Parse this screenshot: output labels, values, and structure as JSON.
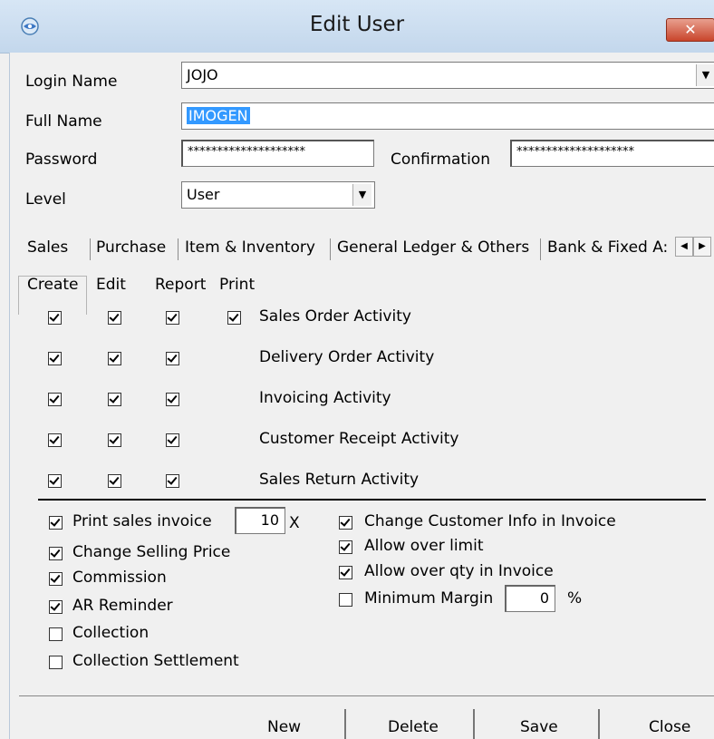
{
  "window": {
    "title": "Edit User",
    "close_label": "✕"
  },
  "form": {
    "login_name_label": "Login Name",
    "login_name_value": "JOJO",
    "full_name_label": "Full Name",
    "full_name_value": "IMOGEN",
    "password_label": "Password",
    "password_value": "********************",
    "confirmation_label": "Confirmation",
    "confirmation_value": "********************",
    "level_label": "Level",
    "level_value": "User"
  },
  "tabs": [
    {
      "label": "Sales",
      "active": true
    },
    {
      "label": "Purchase"
    },
    {
      "label": "Item & Inventory"
    },
    {
      "label": "General Ledger & Others"
    },
    {
      "label": "Bank & Fixed A:"
    }
  ],
  "columns": {
    "create": "Create",
    "edit": "Edit",
    "report": "Report",
    "print": "Print"
  },
  "activities": [
    {
      "label": "Sales Order Activity",
      "create": true,
      "edit": true,
      "report": true,
      "print": true
    },
    {
      "label": "Delivery Order Activity",
      "create": true,
      "edit": true,
      "report": true
    },
    {
      "label": "Invoicing Activity",
      "create": true,
      "edit": true,
      "report": true
    },
    {
      "label": "Customer Receipt Activity",
      "create": true,
      "edit": true,
      "report": true
    },
    {
      "label": "Sales Return Activity",
      "create": true,
      "edit": true,
      "report": true
    }
  ],
  "options_left": [
    {
      "label": "Print sales invoice",
      "checked": true
    },
    {
      "label": "Change Selling Price",
      "checked": true
    },
    {
      "label": "Commission",
      "checked": true
    },
    {
      "label": "AR Reminder",
      "checked": true
    },
    {
      "label": "Collection",
      "checked": false
    },
    {
      "label": "Collection Settlement",
      "checked": false
    }
  ],
  "print_count": {
    "value": "10",
    "suffix": "X"
  },
  "options_right": [
    {
      "label": "Change Customer Info in Invoice",
      "checked": true
    },
    {
      "label": "Allow over limit",
      "checked": true
    },
    {
      "label": "Allow over qty in Invoice",
      "checked": true
    },
    {
      "label": "Minimum Margin",
      "checked": false
    }
  ],
  "minimum_margin": {
    "value": "0",
    "suffix": "%"
  },
  "buttons": {
    "new": "New",
    "delete": "Delete",
    "save": "Save",
    "close": "Close"
  },
  "colors": {
    "title_bar": "#c9dcef",
    "selection": "#3399ff",
    "close_button": "#c9452c"
  }
}
